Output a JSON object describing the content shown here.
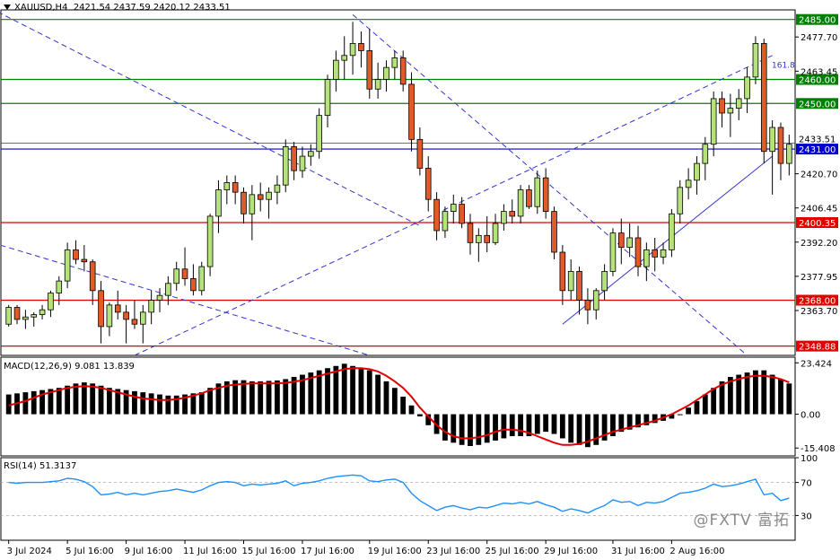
{
  "header": {
    "symbol": "XAUUSD,H4",
    "ohlc": "2421.54 2437.59 2420.12 2433.51"
  },
  "macd_label": "MACD(12,26,9) 9.081 13.839",
  "rsi_label": "RSI(14) 51.3137",
  "watermark": "@FXTV 富拓",
  "fib_label": "161.8",
  "price_axis": {
    "ticks": [
      "2477.70",
      "2463.45",
      "2420.70",
      "2406.45",
      "2392.20",
      "2377.95",
      "2363.70"
    ],
    "min": 2345,
    "max": 2489
  },
  "levels": [
    {
      "value": 2485.0,
      "label": "2485.00",
      "color": "#008000"
    },
    {
      "value": 2460.0,
      "label": "2460.00",
      "color": "#008000"
    },
    {
      "value": 2450.0,
      "label": "2450.00",
      "color": "#008000"
    },
    {
      "value": 2400.35,
      "label": "2400.35",
      "color": "#e00000"
    },
    {
      "value": 2368.0,
      "label": "2368.00",
      "color": "#e00000"
    },
    {
      "value": 2348.88,
      "label": "2348.88",
      "color": "#e00000"
    }
  ],
  "current": {
    "value": 2433.51,
    "label": "2433.51"
  },
  "blue_level": {
    "value": 2431.0,
    "label": "2431.00",
    "color": "#0000cc"
  },
  "macd_axis": {
    "ticks": [
      "23.424",
      "0.00",
      "-15.408"
    ],
    "values": [
      23.424,
      0,
      -15.408
    ],
    "min": -19,
    "max": 26
  },
  "rsi_axis": {
    "ticks": [
      "100",
      "70",
      "30"
    ],
    "values": [
      100,
      70,
      30
    ]
  },
  "x_axis": {
    "labels": [
      "3 Jul 2024",
      "5 Jul 16:00",
      "9 Jul 16:00",
      "11 Jul 16:00",
      "15 Jul 16:00",
      "17 Jul 16:00",
      "19 Jul 16:00",
      "23 Jul 16:00",
      "25 Jul 16:00",
      "29 Jul 16:00",
      "31 Jul 16:00",
      "2 Aug 16:00"
    ],
    "label_index": [
      0,
      7,
      14,
      21,
      28,
      35,
      43,
      50,
      57,
      64,
      72,
      79
    ]
  },
  "colors": {
    "bull": "#b5e27a",
    "bear": "#e05a2a",
    "wick": "#000000",
    "macd_signal": "#e00000",
    "rsi": "#1e90ff",
    "trend": "#3333cc"
  },
  "chart_data": {
    "type": "candlestick",
    "title": "XAUUSD,H4",
    "candles": [
      [
        2358,
        2366,
        2357,
        2365
      ],
      [
        2365,
        2366,
        2358,
        2360
      ],
      [
        2360,
        2364,
        2356,
        2361
      ],
      [
        2361,
        2363,
        2357,
        2362
      ],
      [
        2362,
        2366,
        2360,
        2364
      ],
      [
        2364,
        2372,
        2361,
        2371
      ],
      [
        2371,
        2378,
        2366,
        2376
      ],
      [
        2376,
        2392,
        2373,
        2389
      ],
      [
        2389,
        2393,
        2383,
        2385
      ],
      [
        2385,
        2391,
        2380,
        2384
      ],
      [
        2384,
        2385,
        2366,
        2372
      ],
      [
        2372,
        2376,
        2350,
        2357
      ],
      [
        2357,
        2367,
        2353,
        2366
      ],
      [
        2366,
        2372,
        2360,
        2363
      ],
      [
        2363,
        2366,
        2350,
        2360
      ],
      [
        2360,
        2368,
        2356,
        2358
      ],
      [
        2358,
        2366,
        2350,
        2363
      ],
      [
        2363,
        2372,
        2358,
        2368
      ],
      [
        2368,
        2373,
        2363,
        2370
      ],
      [
        2370,
        2378,
        2366,
        2375
      ],
      [
        2375,
        2384,
        2372,
        2381
      ],
      [
        2381,
        2390,
        2374,
        2377
      ],
      [
        2377,
        2383,
        2370,
        2372
      ],
      [
        2372,
        2384,
        2370,
        2382
      ],
      [
        2382,
        2404,
        2378,
        2403
      ],
      [
        2403,
        2418,
        2396,
        2414
      ],
      [
        2414,
        2420,
        2408,
        2417
      ],
      [
        2417,
        2420,
        2408,
        2413
      ],
      [
        2413,
        2415,
        2400,
        2404
      ],
      [
        2404,
        2416,
        2393,
        2412
      ],
      [
        2412,
        2417,
        2405,
        2410
      ],
      [
        2410,
        2415,
        2402,
        2413
      ],
      [
        2413,
        2420,
        2408,
        2416
      ],
      [
        2416,
        2435,
        2413,
        2432
      ],
      [
        2432,
        2434,
        2418,
        2422
      ],
      [
        2422,
        2432,
        2419,
        2428
      ],
      [
        2428,
        2433,
        2424,
        2430
      ],
      [
        2430,
        2448,
        2427,
        2445
      ],
      [
        2445,
        2462,
        2440,
        2460
      ],
      [
        2460,
        2472,
        2455,
        2468
      ],
      [
        2468,
        2478,
        2460,
        2470
      ],
      [
        2470,
        2484,
        2462,
        2475
      ],
      [
        2475,
        2480,
        2465,
        2472
      ],
      [
        2472,
        2481,
        2452,
        2456
      ],
      [
        2456,
        2467,
        2452,
        2460
      ],
      [
        2460,
        2468,
        2455,
        2465
      ],
      [
        2465,
        2472,
        2460,
        2469
      ],
      [
        2469,
        2472,
        2455,
        2458
      ],
      [
        2458,
        2463,
        2430,
        2435
      ],
      [
        2435,
        2440,
        2420,
        2423
      ],
      [
        2423,
        2428,
        2405,
        2410
      ],
      [
        2410,
        2413,
        2393,
        2397
      ],
      [
        2397,
        2407,
        2394,
        2405
      ],
      [
        2405,
        2412,
        2400,
        2408
      ],
      [
        2408,
        2411,
        2398,
        2400
      ],
      [
        2400,
        2404,
        2387,
        2392
      ],
      [
        2392,
        2398,
        2384,
        2395
      ],
      [
        2395,
        2403,
        2388,
        2392
      ],
      [
        2392,
        2404,
        2391,
        2400
      ],
      [
        2400,
        2408,
        2397,
        2405
      ],
      [
        2405,
        2410,
        2400,
        2403
      ],
      [
        2403,
        2416,
        2400,
        2414
      ],
      [
        2414,
        2416,
        2406,
        2407
      ],
      [
        2407,
        2422,
        2404,
        2419
      ],
      [
        2419,
        2423,
        2402,
        2405
      ],
      [
        2405,
        2407,
        2385,
        2388
      ],
      [
        2388,
        2391,
        2366,
        2372
      ],
      [
        2372,
        2385,
        2368,
        2380
      ],
      [
        2380,
        2382,
        2362,
        2368
      ],
      [
        2368,
        2373,
        2358,
        2364
      ],
      [
        2364,
        2373,
        2360,
        2372
      ],
      [
        2372,
        2383,
        2368,
        2380
      ],
      [
        2380,
        2398,
        2378,
        2396
      ],
      [
        2396,
        2402,
        2383,
        2390
      ],
      [
        2390,
        2400,
        2386,
        2394
      ],
      [
        2394,
        2399,
        2378,
        2382
      ],
      [
        2382,
        2392,
        2376,
        2389
      ],
      [
        2389,
        2394,
        2380,
        2386
      ],
      [
        2386,
        2392,
        2383,
        2389
      ],
      [
        2389,
        2406,
        2386,
        2404
      ],
      [
        2404,
        2418,
        2400,
        2415
      ],
      [
        2415,
        2423,
        2410,
        2418
      ],
      [
        2418,
        2428,
        2412,
        2425
      ],
      [
        2425,
        2436,
        2418,
        2433
      ],
      [
        2433,
        2455,
        2428,
        2452
      ],
      [
        2452,
        2455,
        2440,
        2446
      ],
      [
        2446,
        2454,
        2436,
        2448
      ],
      [
        2448,
        2456,
        2443,
        2452
      ],
      [
        2452,
        2465,
        2446,
        2461
      ],
      [
        2461,
        2478,
        2458,
        2475
      ],
      [
        2475,
        2477,
        2425,
        2430
      ],
      [
        2430,
        2443,
        2412,
        2440
      ],
      [
        2440,
        2442,
        2418,
        2425
      ],
      [
        2425,
        2437,
        2420,
        2433
      ]
    ],
    "macd_histogram": [
      9,
      9.5,
      10,
      10.5,
      11,
      11.5,
      12,
      13,
      14,
      14.5,
      14,
      13,
      12,
      11.5,
      11,
      10.5,
      10,
      9.5,
      9,
      8.5,
      8.5,
      9,
      9.5,
      10,
      12,
      14,
      15,
      15.5,
      15.5,
      15,
      15,
      15.2,
      15.4,
      16,
      17,
      18,
      19,
      20,
      21,
      22,
      23,
      22,
      21,
      20,
      18,
      15,
      12,
      8,
      4,
      -1,
      -5,
      -9,
      -12,
      -13,
      -14,
      -14.5,
      -14,
      -13,
      -12,
      -11,
      -10,
      -10,
      -10,
      -9,
      -8,
      -9,
      -11,
      -13,
      -14,
      -15,
      -14,
      -12,
      -10,
      -8,
      -7,
      -6,
      -5,
      -4,
      -3,
      -2,
      0,
      3,
      6,
      9,
      12,
      15,
      17,
      18,
      19,
      20,
      20,
      18,
      16,
      14
    ],
    "macd_signal": [
      4,
      5,
      6,
      7.5,
      9,
      10,
      11,
      12,
      12.5,
      12.8,
      12.6,
      12,
      11,
      10,
      9,
      8,
      7.2,
      6.8,
      6.5,
      6.5,
      6.8,
      7.5,
      8.5,
      9.5,
      11,
      12,
      13,
      13.5,
      13.8,
      14,
      14,
      14,
      14.1,
      14.3,
      14.8,
      15.5,
      16.5,
      17.5,
      18.5,
      19.5,
      20.5,
      21,
      21,
      20.5,
      19.5,
      17.5,
      15,
      12,
      8,
      3,
      -1,
      -5,
      -8,
      -10,
      -11,
      -11,
      -10.5,
      -9.5,
      -8,
      -7,
      -7,
      -7.5,
      -8.5,
      -10,
      -11.5,
      -13,
      -14,
      -14,
      -13.5,
      -12.5,
      -11,
      -9.5,
      -8,
      -7,
      -6,
      -5,
      -4,
      -3,
      -1.5,
      0,
      2,
      4,
      6.5,
      9,
      11.5,
      13.5,
      15,
      16,
      17,
      17.5,
      17.5,
      17,
      16,
      14.5
    ],
    "rsi": [
      70,
      69,
      70,
      70,
      70,
      71,
      72,
      75,
      74,
      71,
      65,
      55,
      56,
      58,
      55,
      57,
      55,
      57,
      59,
      60,
      62,
      60,
      58,
      61,
      66,
      70,
      71,
      70,
      66,
      68,
      67,
      68,
      69,
      72,
      66,
      69,
      70,
      72,
      75,
      77,
      78,
      79,
      78,
      72,
      71,
      73,
      74,
      70,
      57,
      48,
      42,
      36,
      40,
      42,
      39,
      37,
      40,
      39,
      42,
      45,
      44,
      46,
      44,
      47,
      43,
      40,
      35,
      38,
      36,
      33,
      38,
      42,
      49,
      46,
      47,
      42,
      46,
      45,
      47,
      52,
      57,
      58,
      60,
      63,
      68,
      65,
      66,
      68,
      71,
      74,
      55,
      57,
      48,
      51
    ]
  }
}
